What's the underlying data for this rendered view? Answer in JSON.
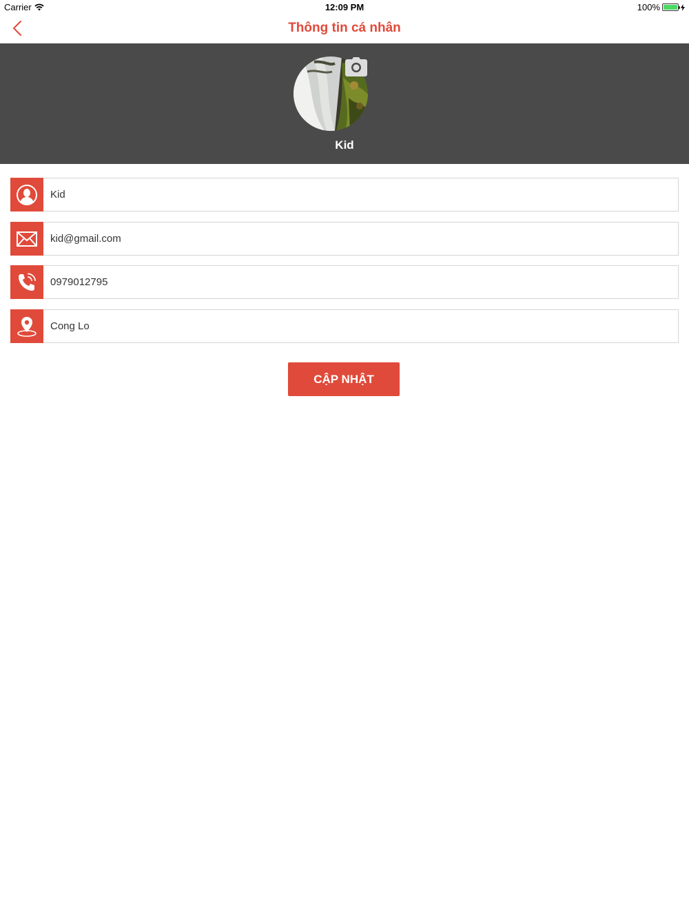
{
  "status_bar": {
    "carrier": "Carrier",
    "time": "12:09 PM",
    "battery": "100%"
  },
  "nav": {
    "title": "Thông tin cá nhân"
  },
  "profile": {
    "name": "Kid"
  },
  "fields": {
    "name": "Kid",
    "email": "kid@gmail.com",
    "phone": "0979012795",
    "address": "Cong Lo"
  },
  "actions": {
    "update_label": "CẬP NHẬT"
  },
  "colors": {
    "accent": "#e04a3a",
    "header_bg": "#4a4a4a"
  }
}
